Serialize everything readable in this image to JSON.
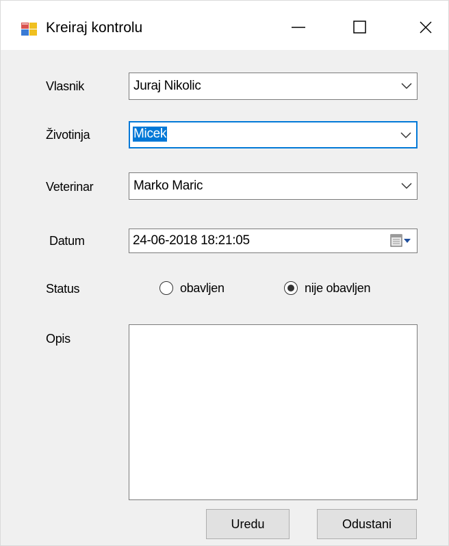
{
  "window": {
    "title": "Kreiraj kontrolu",
    "controls": {
      "minimize": "minimize",
      "maximize": "maximize",
      "close": "close"
    }
  },
  "form": {
    "vlasnik": {
      "label": "Vlasnik",
      "value": "Juraj Nikolic"
    },
    "zivotinja": {
      "label": "Životinja",
      "value": "Micek"
    },
    "veterinar": {
      "label": "Veterinar",
      "value": "Marko Maric"
    },
    "datum": {
      "label": "Datum",
      "value": "24-06-2018 18:21:05"
    },
    "status": {
      "label": "Status",
      "options": [
        {
          "label": "obavljen",
          "selected": false
        },
        {
          "label": "nije obavljen",
          "selected": true
        }
      ]
    },
    "opis": {
      "label": "Opis",
      "value": ""
    }
  },
  "buttons": {
    "ok": "Uredu",
    "cancel": "Odustani"
  },
  "colors": {
    "accent": "#0078d7",
    "background": "#f0f0f0",
    "button": "#e1e1e1"
  }
}
